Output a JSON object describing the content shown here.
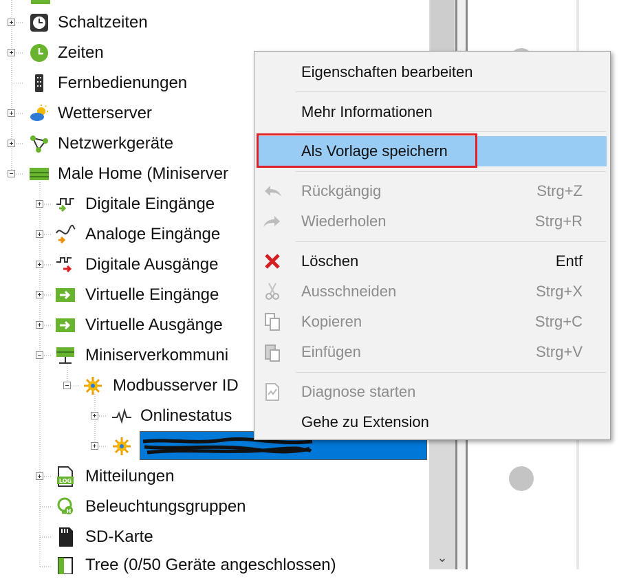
{
  "tree": {
    "items": [
      {
        "label": "Schaltzeiten",
        "icon": "clock-icon",
        "expand": "plus"
      },
      {
        "label": "Zeiten",
        "icon": "green-clock-icon",
        "expand": "plus"
      },
      {
        "label": "Fernbedienungen",
        "icon": "remote-icon",
        "expand": "none"
      },
      {
        "label": "Wetterserver",
        "icon": "weather-icon",
        "expand": "plus"
      },
      {
        "label": "Netzwerkgeräte",
        "icon": "network-icon",
        "expand": "plus"
      },
      {
        "label": "Male Home (Miniserver",
        "icon": "miniserver-icon",
        "expand": "minus"
      },
      {
        "label": "Digitale Eingänge",
        "icon": "digital-input-icon",
        "expand": "plus"
      },
      {
        "label": "Analoge Eingänge",
        "icon": "analog-input-icon",
        "expand": "plus"
      },
      {
        "label": "Digitale Ausgänge",
        "icon": "digital-output-icon",
        "expand": "plus"
      },
      {
        "label": "Virtuelle Eingänge",
        "icon": "virtual-input-icon",
        "expand": "plus"
      },
      {
        "label": "Virtuelle Ausgänge",
        "icon": "virtual-output-icon",
        "expand": "plus"
      },
      {
        "label": "Miniserverkommuni",
        "icon": "network-device-icon",
        "expand": "minus"
      },
      {
        "label": "Modbusserver ID",
        "icon": "modbus-icon",
        "expand": "minus"
      },
      {
        "label": "Onlinestatus",
        "icon": "pulse-icon",
        "expand": "plus"
      },
      {
        "label": "",
        "icon": "modbus-icon",
        "expand": "plus",
        "selected": true
      },
      {
        "label": "Mitteilungen",
        "icon": "log-icon",
        "expand": "plus"
      },
      {
        "label": "Beleuchtungsgruppen",
        "icon": "light-group-icon",
        "expand": "none"
      },
      {
        "label": "SD-Karte",
        "icon": "sd-card-icon",
        "expand": "none"
      },
      {
        "label": "Tree  (0/50 Geräte angeschlossen)",
        "icon": "tree-icon",
        "expand": "none"
      }
    ]
  },
  "context_menu": {
    "items": [
      {
        "label": "Eigenschaften bearbeiten",
        "shortcut": "",
        "icon": "",
        "disabled": false
      },
      {
        "label": "Mehr Informationen",
        "shortcut": "",
        "icon": "",
        "disabled": false
      },
      {
        "label": "Als Vorlage speichern",
        "shortcut": "",
        "icon": "",
        "disabled": false,
        "highlighted": true
      },
      {
        "label": "Rückgängig",
        "shortcut": "Strg+Z",
        "icon": "undo-icon",
        "disabled": true
      },
      {
        "label": "Wiederholen",
        "shortcut": "Strg+R",
        "icon": "redo-icon",
        "disabled": true
      },
      {
        "label": "Löschen",
        "shortcut": "Entf",
        "icon": "delete-icon",
        "disabled": false
      },
      {
        "label": "Ausschneiden",
        "shortcut": "Strg+X",
        "icon": "cut-icon",
        "disabled": true
      },
      {
        "label": "Kopieren",
        "shortcut": "Strg+C",
        "icon": "copy-icon",
        "disabled": true
      },
      {
        "label": "Einfügen",
        "shortcut": "Strg+V",
        "icon": "paste-icon",
        "disabled": true
      },
      {
        "label": "Diagnose starten",
        "shortcut": "",
        "icon": "diagnose-icon",
        "disabled": true
      },
      {
        "label": "Gehe zu Extension",
        "shortcut": "",
        "icon": "",
        "disabled": false
      }
    ]
  },
  "colors": {
    "highlight": "#99ccf5",
    "selection": "#0078d7",
    "annotation_box": "#e0202a",
    "loxone_green": "#69b42e"
  }
}
